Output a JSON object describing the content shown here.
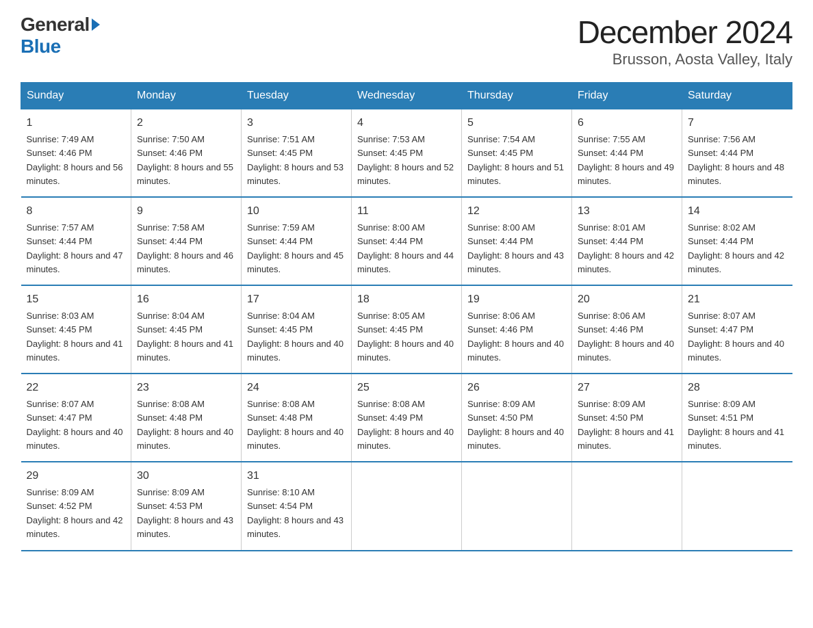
{
  "logo": {
    "general": "General",
    "blue": "Blue"
  },
  "title": "December 2024",
  "subtitle": "Brusson, Aosta Valley, Italy",
  "days_header": [
    "Sunday",
    "Monday",
    "Tuesday",
    "Wednesday",
    "Thursday",
    "Friday",
    "Saturday"
  ],
  "weeks": [
    [
      {
        "num": "1",
        "sunrise": "7:49 AM",
        "sunset": "4:46 PM",
        "daylight": "8 hours and 56 minutes."
      },
      {
        "num": "2",
        "sunrise": "7:50 AM",
        "sunset": "4:46 PM",
        "daylight": "8 hours and 55 minutes."
      },
      {
        "num": "3",
        "sunrise": "7:51 AM",
        "sunset": "4:45 PM",
        "daylight": "8 hours and 53 minutes."
      },
      {
        "num": "4",
        "sunrise": "7:53 AM",
        "sunset": "4:45 PM",
        "daylight": "8 hours and 52 minutes."
      },
      {
        "num": "5",
        "sunrise": "7:54 AM",
        "sunset": "4:45 PM",
        "daylight": "8 hours and 51 minutes."
      },
      {
        "num": "6",
        "sunrise": "7:55 AM",
        "sunset": "4:44 PM",
        "daylight": "8 hours and 49 minutes."
      },
      {
        "num": "7",
        "sunrise": "7:56 AM",
        "sunset": "4:44 PM",
        "daylight": "8 hours and 48 minutes."
      }
    ],
    [
      {
        "num": "8",
        "sunrise": "7:57 AM",
        "sunset": "4:44 PM",
        "daylight": "8 hours and 47 minutes."
      },
      {
        "num": "9",
        "sunrise": "7:58 AM",
        "sunset": "4:44 PM",
        "daylight": "8 hours and 46 minutes."
      },
      {
        "num": "10",
        "sunrise": "7:59 AM",
        "sunset": "4:44 PM",
        "daylight": "8 hours and 45 minutes."
      },
      {
        "num": "11",
        "sunrise": "8:00 AM",
        "sunset": "4:44 PM",
        "daylight": "8 hours and 44 minutes."
      },
      {
        "num": "12",
        "sunrise": "8:00 AM",
        "sunset": "4:44 PM",
        "daylight": "8 hours and 43 minutes."
      },
      {
        "num": "13",
        "sunrise": "8:01 AM",
        "sunset": "4:44 PM",
        "daylight": "8 hours and 42 minutes."
      },
      {
        "num": "14",
        "sunrise": "8:02 AM",
        "sunset": "4:44 PM",
        "daylight": "8 hours and 42 minutes."
      }
    ],
    [
      {
        "num": "15",
        "sunrise": "8:03 AM",
        "sunset": "4:45 PM",
        "daylight": "8 hours and 41 minutes."
      },
      {
        "num": "16",
        "sunrise": "8:04 AM",
        "sunset": "4:45 PM",
        "daylight": "8 hours and 41 minutes."
      },
      {
        "num": "17",
        "sunrise": "8:04 AM",
        "sunset": "4:45 PM",
        "daylight": "8 hours and 40 minutes."
      },
      {
        "num": "18",
        "sunrise": "8:05 AM",
        "sunset": "4:45 PM",
        "daylight": "8 hours and 40 minutes."
      },
      {
        "num": "19",
        "sunrise": "8:06 AM",
        "sunset": "4:46 PM",
        "daylight": "8 hours and 40 minutes."
      },
      {
        "num": "20",
        "sunrise": "8:06 AM",
        "sunset": "4:46 PM",
        "daylight": "8 hours and 40 minutes."
      },
      {
        "num": "21",
        "sunrise": "8:07 AM",
        "sunset": "4:47 PM",
        "daylight": "8 hours and 40 minutes."
      }
    ],
    [
      {
        "num": "22",
        "sunrise": "8:07 AM",
        "sunset": "4:47 PM",
        "daylight": "8 hours and 40 minutes."
      },
      {
        "num": "23",
        "sunrise": "8:08 AM",
        "sunset": "4:48 PM",
        "daylight": "8 hours and 40 minutes."
      },
      {
        "num": "24",
        "sunrise": "8:08 AM",
        "sunset": "4:48 PM",
        "daylight": "8 hours and 40 minutes."
      },
      {
        "num": "25",
        "sunrise": "8:08 AM",
        "sunset": "4:49 PM",
        "daylight": "8 hours and 40 minutes."
      },
      {
        "num": "26",
        "sunrise": "8:09 AM",
        "sunset": "4:50 PM",
        "daylight": "8 hours and 40 minutes."
      },
      {
        "num": "27",
        "sunrise": "8:09 AM",
        "sunset": "4:50 PM",
        "daylight": "8 hours and 41 minutes."
      },
      {
        "num": "28",
        "sunrise": "8:09 AM",
        "sunset": "4:51 PM",
        "daylight": "8 hours and 41 minutes."
      }
    ],
    [
      {
        "num": "29",
        "sunrise": "8:09 AM",
        "sunset": "4:52 PM",
        "daylight": "8 hours and 42 minutes."
      },
      {
        "num": "30",
        "sunrise": "8:09 AM",
        "sunset": "4:53 PM",
        "daylight": "8 hours and 43 minutes."
      },
      {
        "num": "31",
        "sunrise": "8:10 AM",
        "sunset": "4:54 PM",
        "daylight": "8 hours and 43 minutes."
      },
      null,
      null,
      null,
      null
    ]
  ]
}
